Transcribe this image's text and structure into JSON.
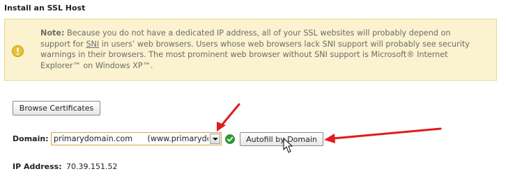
{
  "section": {
    "title": "Install an SSL Host"
  },
  "note": {
    "label": "Note:",
    "text_before": " Because you do not have a dedicated IP address, all of your SSL websites will probably depend on support for ",
    "sni": "SNI",
    "text_after": " in users’ web browsers. Users whose web browsers lack SNI support will probably see security warnings in their browsers. The most prominent web browser without SNI support is Microsoft® Internet Explorer™ on Windows XP™.",
    "icon": "warning-icon",
    "bg_color": "#fbf3cf",
    "border_color": "#e8d98a"
  },
  "browse_button": {
    "label": "Browse Certificates"
  },
  "domain": {
    "label": "Domain:",
    "selected_value": "primarydomain.com      (www.primarydomain.com)",
    "status_icon": "check-circle-icon",
    "status_color": "#2e9c2e"
  },
  "autofill_button": {
    "label": "Autofill by Domain"
  },
  "ip": {
    "label": "IP Address:",
    "value": "70.39.151.52"
  },
  "annotations": {
    "arrow_color": "#e01b1b",
    "arrow_1": "red-arrow-icon",
    "arrow_2": "red-arrow-icon",
    "cursor": "mouse-pointer-icon"
  }
}
